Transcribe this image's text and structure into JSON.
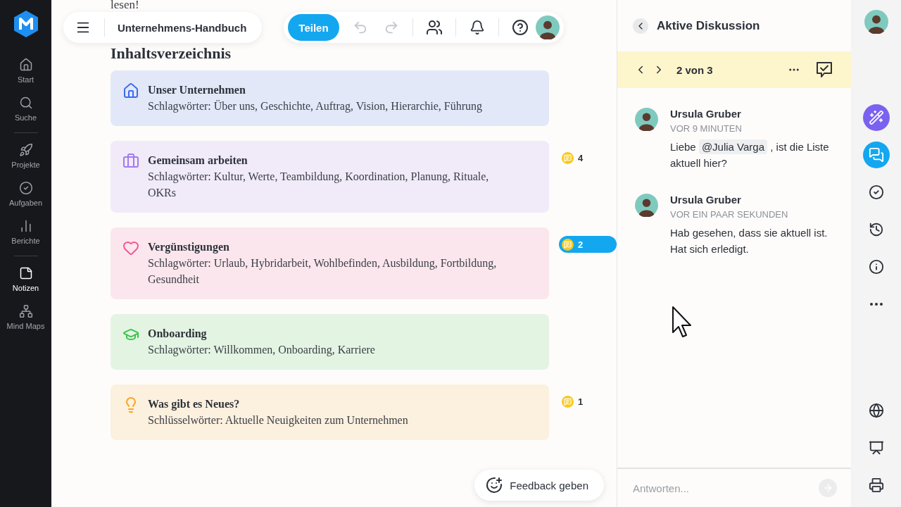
{
  "sidebar": {
    "items": [
      {
        "label": "Start",
        "selected": false
      },
      {
        "label": "Suche",
        "selected": false
      },
      {
        "label": "Projekte",
        "selected": false
      },
      {
        "label": "Aufgaben",
        "selected": false
      },
      {
        "label": "Berichte",
        "selected": false
      },
      {
        "label": "Notizen",
        "selected": true
      },
      {
        "label": "Mind Maps",
        "selected": false
      }
    ]
  },
  "toolbar": {
    "document_title": "Unternehmens-Handbuch",
    "share_button": "Teilen",
    "undo_disabled": true,
    "redo_disabled": true
  },
  "document": {
    "intro_tail": "lesen!",
    "heading": "Inhaltsverzeichnis",
    "sections": [
      {
        "title": "Unser Unternehmen",
        "tags": "Schlagwörter: Über uns, Geschichte, Auftrag, Vision, Hierarchie, Führung",
        "color": "#3d6cf0"
      },
      {
        "title": "Gemeinsam arbeiten",
        "tags": "Schlagwörter: Kultur, Werte, Teambildung, Koordination, Planung, Rituale, OKRs",
        "color": "#a27af0",
        "comments": {
          "count": "4",
          "selected": false
        }
      },
      {
        "title": "Vergünstigungen",
        "tags": "Schlagwörter: Urlaub, Hybridarbeit, Wohlbefinden, Ausbildung, Fortbildung, Gesundheit",
        "color": "#ef5a93",
        "comments": {
          "count": "2",
          "selected": true
        }
      },
      {
        "title": "Onboarding",
        "tags": "Schlagwörter: Willkommen, Onboarding, Karriere",
        "color": "#3cc44a"
      },
      {
        "title": "Was gibt es Neues?",
        "tags": "Schlüsselwörter: Aktuelle Neuigkeiten zum Unternehmen",
        "color": "#f5a623",
        "comments": {
          "count": "1",
          "selected": false
        }
      }
    ]
  },
  "feedback_button": "Feedback geben",
  "discussion": {
    "title": "Aktive Diskussion",
    "position": "2 von 3",
    "comments": [
      {
        "author": "Ursula Gruber",
        "time": "VOR 9 MINUTEN",
        "text_before": "Liebe",
        "mention": "@Julia Varga",
        "text_after": ", ist die Liste aktuell hier?"
      },
      {
        "author": "Ursula Gruber",
        "time": "VOR EIN PAAR SEKUNDEN",
        "text_before": "Hab gesehen, dass sie aktuell ist. Hat sich erledigt."
      }
    ],
    "reply": {
      "placeholder": "Antworten..."
    }
  },
  "rail": {
    "items": [
      {
        "selected": false
      },
      {
        "selected": true
      },
      {
        "selected": false
      },
      {
        "selected": false
      },
      {
        "selected": false
      },
      {
        "selected": false
      },
      {
        "selected": false
      },
      {
        "selected": false
      },
      {
        "selected": false
      }
    ]
  }
}
